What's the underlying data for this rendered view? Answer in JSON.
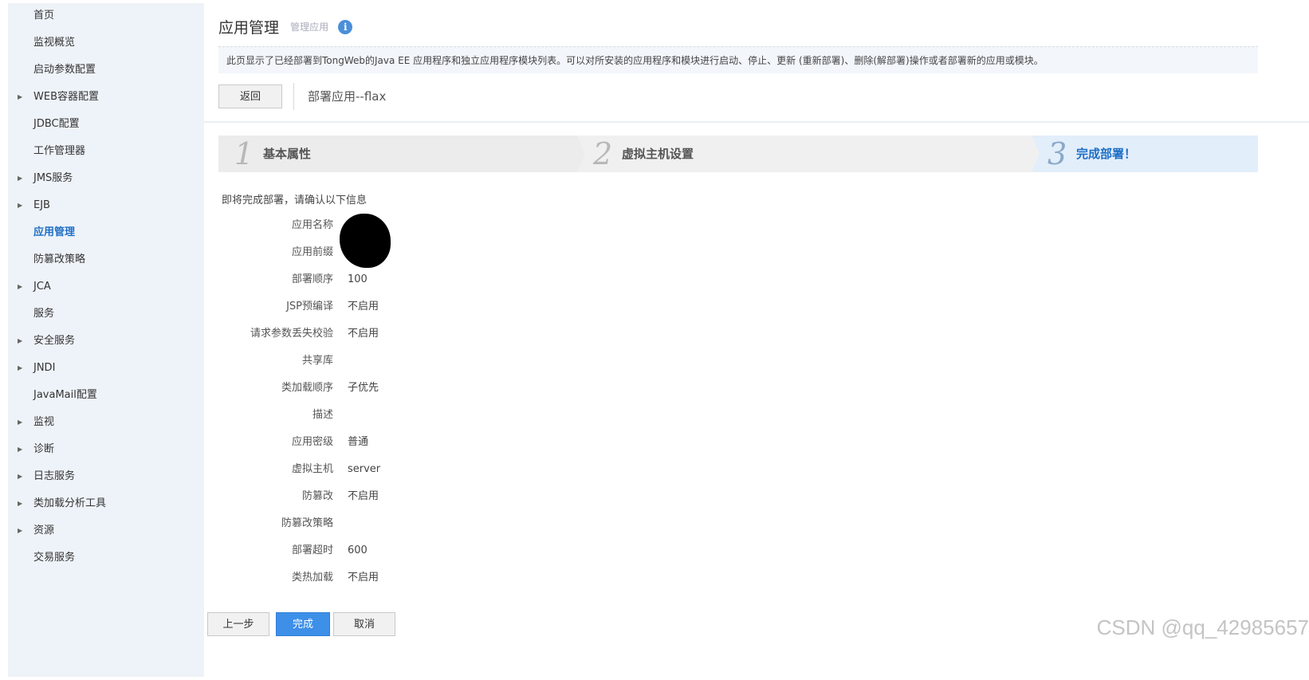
{
  "sidebar": {
    "items": [
      {
        "label": "首页",
        "expandable": false
      },
      {
        "label": "监视概览",
        "expandable": false
      },
      {
        "label": "启动参数配置",
        "expandable": false
      },
      {
        "label": "WEB容器配置",
        "expandable": true
      },
      {
        "label": "JDBC配置",
        "expandable": false
      },
      {
        "label": "工作管理器",
        "expandable": false
      },
      {
        "label": "JMS服务",
        "expandable": true
      },
      {
        "label": "EJB",
        "expandable": true
      },
      {
        "label": "应用管理",
        "expandable": false,
        "active": true
      },
      {
        "label": "防篡改策略",
        "expandable": false
      },
      {
        "label": "JCA",
        "expandable": true
      },
      {
        "label": "服务",
        "expandable": false
      },
      {
        "label": "安全服务",
        "expandable": true
      },
      {
        "label": "JNDI",
        "expandable": true
      },
      {
        "label": "JavaMail配置",
        "expandable": false
      },
      {
        "label": "监视",
        "expandable": true
      },
      {
        "label": "诊断",
        "expandable": true
      },
      {
        "label": "日志服务",
        "expandable": true
      },
      {
        "label": "类加载分析工具",
        "expandable": true
      },
      {
        "label": "资源",
        "expandable": true
      },
      {
        "label": "交易服务",
        "expandable": false
      }
    ]
  },
  "header": {
    "title": "应用管理",
    "subtitle": "管理应用",
    "info_icon": "i"
  },
  "description": "此页显示了已经部署到TongWeb的Java EE 应用程序和独立应用程序模块列表。可以对所安装的应用程序和模块进行启动、停止、更新 (重新部署)、删除(解部署)操作或者部署新的应用或模块。",
  "toolbar": {
    "back_label": "返回",
    "breadcrumb": "部署应用--flax"
  },
  "steps": [
    {
      "num": "1",
      "label": "基本属性",
      "active": false
    },
    {
      "num": "2",
      "label": "虚拟主机设置",
      "active": false
    },
    {
      "num": "3",
      "label": "完成部署！",
      "active": true
    }
  ],
  "confirm_message": "即将完成部署，请确认以下信息",
  "fields": [
    {
      "label": "应用名称",
      "value": ""
    },
    {
      "label": "应用前缀",
      "value": ""
    },
    {
      "label": "部署顺序",
      "value": "100"
    },
    {
      "label": "JSP预编译",
      "value": "不启用"
    },
    {
      "label": "请求参数丢失校验",
      "value": "不启用"
    },
    {
      "label": "共享库",
      "value": ""
    },
    {
      "label": "类加载顺序",
      "value": "子优先"
    },
    {
      "label": "描述",
      "value": ""
    },
    {
      "label": "应用密级",
      "value": "普通"
    },
    {
      "label": "虚拟主机",
      "value": "server"
    },
    {
      "label": "防篡改",
      "value": "不启用"
    },
    {
      "label": "防篡改策略",
      "value": ""
    },
    {
      "label": "部署超时",
      "value": "600"
    },
    {
      "label": "类热加载",
      "value": "不启用"
    }
  ],
  "actions": {
    "prev_label": "上一步",
    "finish_label": "完成",
    "cancel_label": "取消"
  },
  "watermark": "CSDN @qq_42985657",
  "colors": {
    "accent": "#3d8fe8",
    "sidebar_bg": "#eef3f9",
    "active_link": "#1f6fc6"
  }
}
